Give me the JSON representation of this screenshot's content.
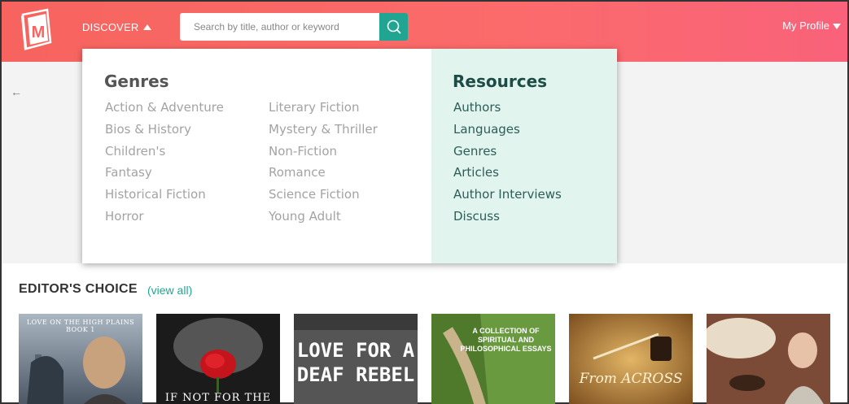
{
  "header": {
    "logo_letter": "M",
    "discover_label": "DISCOVER",
    "search": {
      "placeholder": "Search by title, author or keyword",
      "value": ""
    },
    "profile_label": "My Profile"
  },
  "dropdown": {
    "genres_heading": "Genres",
    "genres_col1": [
      "Action & Adventure",
      "Bios & History",
      "Children's",
      "Fantasy",
      "Historical Fiction",
      "Horror"
    ],
    "genres_col2": [
      "Literary Fiction",
      "Mystery & Thriller",
      "Non-Fiction",
      "Romance",
      "Science Fiction",
      "Young Adult"
    ],
    "resources_heading": "Resources",
    "resources": [
      "Authors",
      "Languages",
      "Genres",
      "Articles",
      "Author Interviews",
      "Discuss"
    ]
  },
  "editors_choice": {
    "title": "EDITOR'S CHOICE",
    "view_all": "(view all)",
    "books": [
      {
        "cover_text": "LOVE ON THE HIGH PLAINS BOOK 1",
        "bg": "#6b7a8a"
      },
      {
        "cover_text": "IF NOT FOR THE",
        "bg": "#1a1a1a"
      },
      {
        "cover_text": "LOVE FOR A DEAF REBEL",
        "bg": "#4a4a4a"
      },
      {
        "cover_text": "A COLLECTION OF SPIRITUAL AND PHILOSOPHICAL ESSAYS",
        "bg": "#5d8a3a"
      },
      {
        "cover_text": "From ACROSS",
        "bg": "#a37a3a"
      },
      {
        "cover_text": "",
        "bg": "#7a4a3a"
      }
    ]
  },
  "colors": {
    "header_accent": "#f7645f",
    "search_button": "#21a593",
    "resources_bg": "#e2f4ee"
  }
}
